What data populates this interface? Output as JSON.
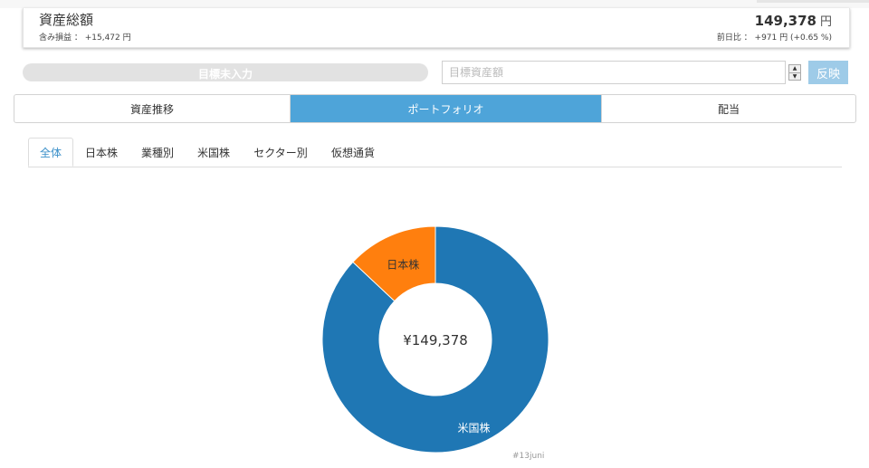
{
  "summary": {
    "title": "資産総額",
    "subtitle": "含み損益 ： +15,472 円",
    "amount": "149,378",
    "amount_unit": "円",
    "change": "前日比 ： +971 円 (+0.65 %)"
  },
  "goal": {
    "bar_label": "目標未入力",
    "input_placeholder": "目標資産額",
    "input_value": "",
    "apply_label": "反映"
  },
  "main_tabs": [
    {
      "label": "資産推移",
      "active": false
    },
    {
      "label": "ポートフォリオ",
      "active": true
    },
    {
      "label": "配当",
      "active": false
    }
  ],
  "sub_tabs": [
    {
      "label": "全体",
      "active": true
    },
    {
      "label": "日本株",
      "active": false
    },
    {
      "label": "業種別",
      "active": false
    },
    {
      "label": "米国株",
      "active": false
    },
    {
      "label": "セクター別",
      "active": false
    },
    {
      "label": "仮想通貨",
      "active": false
    }
  ],
  "chart_data": {
    "type": "pie",
    "center_label": "¥149,378",
    "slices": [
      {
        "label": "米国株",
        "value": 87,
        "color": "#1f77b4"
      },
      {
        "label": "日本株",
        "value": 13,
        "color": "#ff7f0e"
      }
    ]
  },
  "watermark": "#13juni",
  "colors": {
    "accent": "#4ea4d9",
    "active_tab_text": "#3a8fc9",
    "apply_button": "#9ecbe8"
  }
}
